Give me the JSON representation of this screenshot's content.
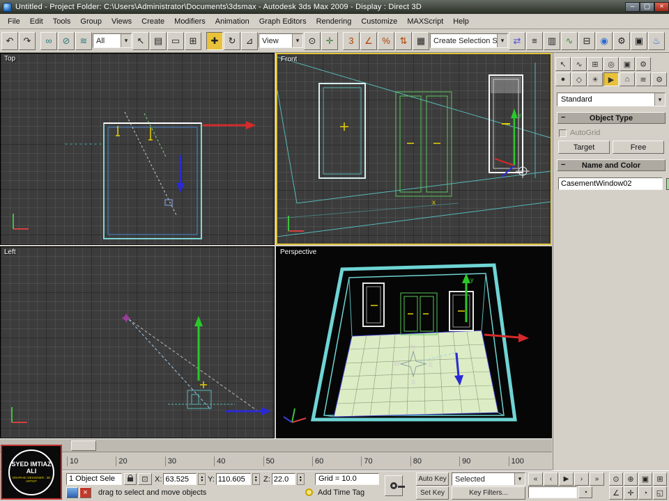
{
  "window": {
    "title": "Untitled     - Project Folder: C:\\Users\\Administrator\\Documents\\3dsmax     - Autodesk 3ds Max  2009       - Display : Direct 3D",
    "controls": [
      {
        "name": "minimize-button",
        "glyph": "–"
      },
      {
        "name": "maximize-button",
        "glyph": "▢"
      },
      {
        "name": "close-button",
        "glyph": "×"
      }
    ]
  },
  "menu": {
    "items": [
      "File",
      "Edit",
      "Tools",
      "Group",
      "Views",
      "Create",
      "Modifiers",
      "Animation",
      "Graph Editors",
      "Rendering",
      "Customize",
      "MAXScript",
      "Help"
    ]
  },
  "toolbar": {
    "icons_a": [
      {
        "name": "undo-icon",
        "glyph": "↶"
      },
      {
        "name": "redo-icon",
        "glyph": "↷"
      }
    ],
    "icons_b": [
      {
        "name": "select-and-link-icon",
        "glyph": "∞",
        "color": "#2a7a7a"
      },
      {
        "name": "unlink-selection-icon",
        "glyph": "⊘",
        "color": "#2a7a7a"
      },
      {
        "name": "bind-to-space-warp-icon",
        "glyph": "≋",
        "color": "#2a7a7a"
      }
    ],
    "selection_filter": "All",
    "icons_c": [
      {
        "name": "select-object-icon",
        "glyph": "↖"
      },
      {
        "name": "select-by-name-icon",
        "glyph": "▤"
      },
      {
        "name": "rectangular-selection-region-icon",
        "glyph": "▭"
      },
      {
        "name": "window-crossing-icon",
        "glyph": "⊞"
      }
    ],
    "icons_d": [
      {
        "name": "select-and-move-icon",
        "glyph": "✚",
        "active": true
      },
      {
        "name": "select-and-rotate-icon",
        "glyph": "↻"
      },
      {
        "name": "select-and-uniform-scale-icon",
        "glyph": "⊿"
      }
    ],
    "reference_coordinate": "View",
    "icons_e": [
      {
        "name": "use-pivot-point-center-icon",
        "glyph": "⊙"
      },
      {
        "name": "select-and-manipulate-icon",
        "glyph": "✛",
        "color": "#3a7a3a"
      }
    ],
    "icons_f": [
      {
        "name": "snaps-toggle-icon",
        "glyph": "3",
        "color": "#b04000"
      },
      {
        "name": "angle-snap-icon",
        "glyph": "∠",
        "color": "#b04000"
      },
      {
        "name": "percent-snap-icon",
        "glyph": "%",
        "color": "#b04000"
      },
      {
        "name": "spinner-snap-icon",
        "glyph": "⇅",
        "color": "#b04000"
      },
      {
        "name": "edit-named-selection-sets-icon",
        "glyph": "▦"
      }
    ],
    "selection_set_label": "Create Selection Set",
    "icons_g": [
      {
        "name": "mirror-icon",
        "glyph": "⇄",
        "color": "#4a4ad4"
      },
      {
        "name": "align-icon",
        "glyph": "≡"
      },
      {
        "name": "layer-manager-icon",
        "glyph": "▥"
      },
      {
        "name": "curve-editor-icon",
        "glyph": "∿",
        "color": "#3a8a3a"
      },
      {
        "name": "schematic-view-icon",
        "glyph": "⊟"
      },
      {
        "name": "material-editor-icon",
        "glyph": "◉",
        "color": "#2a6ad4"
      },
      {
        "name": "render-setup-icon",
        "glyph": "⚙"
      },
      {
        "name": "rendered-frame-window-icon",
        "glyph": "▣"
      },
      {
        "name": "quick-render-icon",
        "glyph": "♨",
        "color": "#2a6ad4"
      }
    ]
  },
  "viewports": {
    "top_label": "Top",
    "front_label": "Front",
    "left_label": "Left",
    "perspective_label": "Perspective",
    "axis_y_label": "y",
    "axis_x_label": "x",
    "compass": {
      "n": "N",
      "s": "S",
      "e": "E",
      "w": "W"
    }
  },
  "command_panel": {
    "tabs": [
      {
        "name": "tab-create-icon",
        "glyph": "↖"
      },
      {
        "name": "tab-modify-icon",
        "glyph": "∿"
      },
      {
        "name": "tab-hierarchy-icon",
        "glyph": "⊞"
      },
      {
        "name": "tab-motion-icon",
        "glyph": "◎"
      },
      {
        "name": "tab-display-icon",
        "glyph": "▣"
      },
      {
        "name": "tab-utilities-icon",
        "glyph": "⚙"
      }
    ],
    "categories": [
      {
        "name": "category-geometry-icon",
        "glyph": "●"
      },
      {
        "name": "category-shapes-icon",
        "glyph": "◇"
      },
      {
        "name": "category-lights-icon",
        "glyph": "☀"
      },
      {
        "name": "category-cameras-icon",
        "glyph": "▶",
        "active": true
      },
      {
        "name": "category-helpers-icon",
        "glyph": "⌂"
      },
      {
        "name": "category-space-warps-icon",
        "glyph": "≋"
      },
      {
        "name": "category-systems-icon",
        "glyph": "⚙"
      }
    ],
    "category_dropdown": "Standard",
    "object_type_title": "Object Type",
    "autogrid_label": "AutoGrid",
    "target_button": "Target",
    "free_button": "Free",
    "name_color_title": "Name and Color",
    "object_name": "CasementWindow02",
    "object_color": "#9fdf9f"
  },
  "timeline": {
    "ticks": [
      "10",
      "20",
      "30",
      "40",
      "50",
      "60",
      "70",
      "80",
      "90",
      "100"
    ]
  },
  "status": {
    "selection_text": "1 Object Sele",
    "x_label": "X:",
    "x_value": "63.525",
    "y_label": "Y:",
    "y_value": "110.605",
    "z_label": "Z:",
    "z_value": "22.0",
    "grid_text": "Grid = 10.0",
    "prompt": "drag to select and move objects",
    "add_time_tag": "Add Time Tag",
    "auto_key": "Auto Key",
    "set_key": "Set Key",
    "selected_dropdown": "Selected",
    "key_filters": "Key Filters...",
    "playback": [
      {
        "name": "go-to-start-button",
        "glyph": "«"
      },
      {
        "name": "previous-frame-button",
        "glyph": "‹"
      },
      {
        "name": "play-button",
        "glyph": "▶"
      },
      {
        "name": "next-frame-button",
        "glyph": "›"
      },
      {
        "name": "go-to-end-button",
        "glyph": "»"
      }
    ],
    "nav_row1": [
      {
        "name": "zoom-icon",
        "glyph": "⊙"
      },
      {
        "name": "zoom-all-icon",
        "glyph": "⊕"
      },
      {
        "name": "zoom-extents-icon",
        "glyph": "▣"
      },
      {
        "name": "zoom-extents-all-icon",
        "glyph": "⊞"
      }
    ],
    "nav_row2": [
      {
        "name": "field-of-view-icon",
        "glyph": "∠"
      },
      {
        "name": "pan-icon",
        "glyph": "✛"
      },
      {
        "name": "arc-rotate-icon",
        "glyph": "◔"
      },
      {
        "name": "maximize-viewport-toggle-icon",
        "glyph": "◱"
      }
    ]
  },
  "watermark": {
    "line1": "SYED IMTIAZ ALI",
    "line2": "GRAPHIC DESIGNER : 3D ARTIST"
  }
}
